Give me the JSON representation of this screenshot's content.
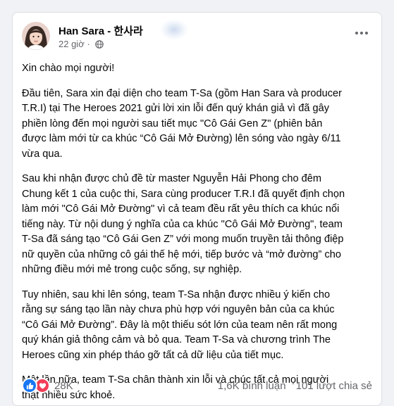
{
  "post": {
    "author": "Han Sara - 한사라",
    "time": "22 giờ",
    "separator": "·",
    "paragraphs": [
      "Xin chào mọi người!",
      "Đầu tiên, Sara xin đại diện cho team T-Sa (gồm Han Sara và producer\nT.R.I) tại The Heroes 2021 gửi lời xin lỗi đến quý khán giả vì đã gây\nphiền lòng đến mọi người sau tiết mục \"Cô Gái Gen Z\" (phiên bản\nđược làm mới từ ca khúc “Cô Gái Mở Đường) lên sóng vào ngày 6/11\nvừa qua.",
      "Sau khi nhận được chủ đề từ master Nguyễn Hải Phong cho đêm\nChung kết 1 của cuộc thi, Sara cùng producer T.R.I đã quyết định chọn\nlàm mới \"Cô Gái Mở Đường\" vì cả team đều rất yêu thích ca khúc nổi\ntiếng này. Từ nội dung ý nghĩa của ca khúc \"Cô Gái Mở Đường\", team\nT-Sa đã sáng tạo “Cô Gái Gen Z” với mong muốn truyền tải thông điệp\nnữ quyền của những cô gái thế hệ mới, tiếp bước và “mở đường” cho\nnhững điều mới mẻ trong cuộc sống, sự nghiệp.",
      "Tuy nhiên, sau khi lên sóng, team T-Sa nhận được nhiều ý kiến cho\nrằng sự sáng tạo lần này chưa phù hợp với nguyên bản của ca khúc\n“Cô Gái Mở Đường”. Đây là một thiếu sót lớn của team nên rất mong\nquý khán giả thông cảm và bỏ qua. Team T-Sa và chương trình The\nHeroes cũng xin phép tháo gỡ tất cả dữ liệu của tiết mục.",
      "Một lần nữa, team T-Sa chân thành xin lỗi và chúc tất cả mọi người\nthật nhiều sức khoẻ."
    ]
  },
  "footer": {
    "reactions_count": "28K",
    "comments": "1,6K bình luận",
    "shares": "101 lượt chia sẻ"
  },
  "colors": {
    "like": "#1877f2",
    "love": "#f33e58",
    "muted": "#65676b"
  },
  "icons": [
    "globe-icon",
    "more-options-icon",
    "like-reaction-icon",
    "love-reaction-icon"
  ]
}
